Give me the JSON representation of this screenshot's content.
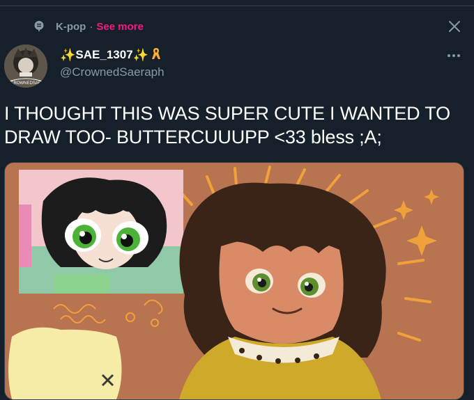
{
  "topic": {
    "label": "K-pop",
    "separator": "·",
    "see_more": "See more"
  },
  "user": {
    "sparkle_left": "✨",
    "name": "SAE_1307",
    "sparkle_right": "✨",
    "handle": "@CrownedSaeraph",
    "avatar_text": "CROWNEDSAE"
  },
  "tweet": {
    "text": "I THOUGHT THIS WAS SUPER CUTE I WANTED TO DRAW TOO- BUTTERCUUUPP <33 bless ;A;"
  },
  "icons": {
    "topic": "topic-bubble-icon",
    "close": "close-icon",
    "more": "more-icon",
    "ribbon": "ribbon-icon"
  },
  "colors": {
    "background": "#15202b",
    "secondary_text": "#8b98a5",
    "see_more": "#f91880",
    "sparkle": "#ffcc4d"
  }
}
